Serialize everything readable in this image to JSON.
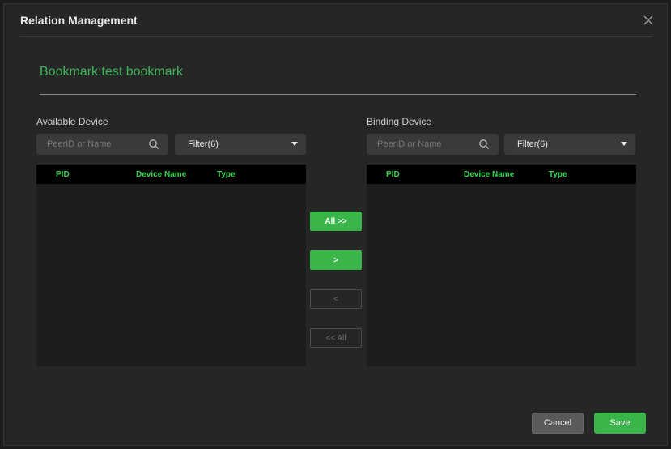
{
  "dialog": {
    "title": "Relation Management"
  },
  "bookmark": {
    "text": "Bookmark:test bookmark"
  },
  "available": {
    "label": "Available Device",
    "search_placeholder": "PeerID or Name",
    "filter_label": "Filter(6)",
    "columns": [
      "PID",
      "Device Name",
      "Type"
    ],
    "rows": []
  },
  "binding": {
    "label": "Binding Device",
    "search_placeholder": "PeerID or Name",
    "filter_label": "Filter(6)",
    "columns": [
      "PID",
      "Device Name",
      "Type"
    ],
    "rows": []
  },
  "transfer": {
    "all_right": "All >>",
    "right": ">",
    "left": "<",
    "all_left": "<< All"
  },
  "footer": {
    "cancel": "Cancel",
    "save": "Save"
  },
  "colors": {
    "accent": "#3ab54a",
    "header_text": "#36d651",
    "bookmark_text": "#3fb559",
    "background": "#262626"
  },
  "icons": {
    "close": "close-icon",
    "search": "search-icon",
    "dropdown": "caret-down-icon"
  }
}
